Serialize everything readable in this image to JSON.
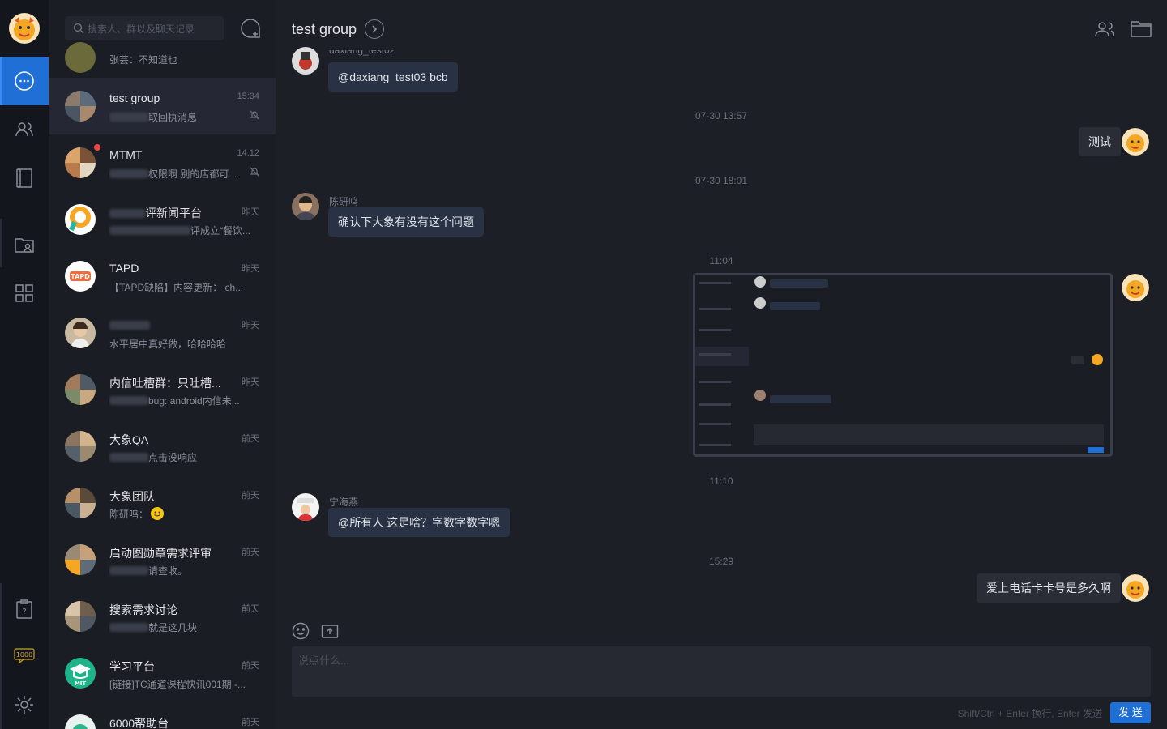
{
  "search": {
    "placeholder": "搜索人、群以及聊天记录"
  },
  "conversations": [
    {
      "name": "",
      "preview": "张芸：不知道也",
      "time": "",
      "partial": true
    },
    {
      "name": "test group",
      "preview": "取回执消息",
      "time": "15:34",
      "muted": true,
      "active": true
    },
    {
      "name": "MTMT",
      "preview": "权限啊 别的店都可...",
      "time": "14:12",
      "muted": true,
      "unread": true
    },
    {
      "name": "评新闻平台",
      "preview": "评成立“餐饮...",
      "time": "昨天"
    },
    {
      "name": "TAPD",
      "preview": "【TAPD缺陷】内容更新： ch...",
      "time": "昨天"
    },
    {
      "name": "",
      "preview": "水平居中真好做，哈哈哈哈",
      "time": "昨天"
    },
    {
      "name": "内信吐槽群：只吐槽...",
      "preview": "bug: android内信未...",
      "time": "昨天"
    },
    {
      "name": "大象QA",
      "preview": "点击没响应",
      "time": "前天"
    },
    {
      "name": "大象团队",
      "preview": "陈研鸣：",
      "time": "前天"
    },
    {
      "name": "启动图勋章需求评审",
      "preview": "请查收。",
      "time": "前天"
    },
    {
      "name": "搜索需求讨论",
      "preview": "就是这几块",
      "time": "前天"
    },
    {
      "name": "学习平台",
      "preview": "[链接]TC通道课程快讯001期 -...",
      "time": "前天"
    },
    {
      "name": "6000帮助台",
      "preview": "",
      "time": "前天"
    }
  ],
  "chat": {
    "title": "test group",
    "top_sender": "daxiang_test02",
    "messages": [
      {
        "text": "@daxiang_test03 bcb"
      },
      {
        "time": "07-30 13:57"
      },
      {
        "text": "测试"
      },
      {
        "time": "07-30 18:01"
      },
      {
        "sender": "陈研鸣",
        "text": "确认下大象有没有这个问题"
      },
      {
        "time": "11:04"
      },
      {
        "time": "11:10"
      },
      {
        "sender": "宁海燕",
        "text": "@所有人 这是啥？字数字数字嗯"
      },
      {
        "time": "15:29"
      },
      {
        "text": "爱上电话卡卡号是多久啊"
      }
    ]
  },
  "composer": {
    "placeholder": "说点什么...",
    "hint": "Shift/Ctrl + Enter 换行, Enter 发送",
    "send_label": "发 送"
  },
  "icons": [
    "message-icon",
    "contacts-icon",
    "notebook-icon",
    "folder-person-icon",
    "apps-icon",
    "help-icon",
    "counter-icon",
    "settings-icon"
  ],
  "rail": {
    "counter": "1000"
  },
  "colors": {
    "accent": "#1f6fd6",
    "bg": "#1d1f27",
    "sidebar": "#14161d"
  }
}
